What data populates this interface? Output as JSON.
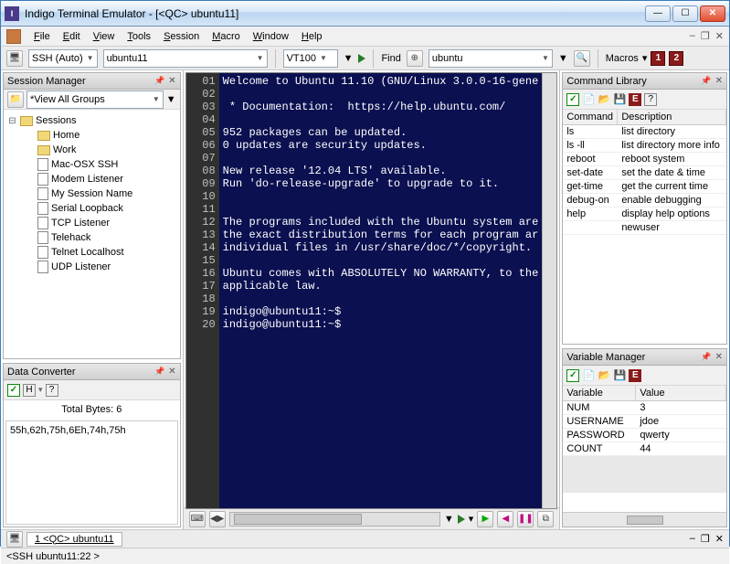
{
  "window": {
    "title": "Indigo Terminal Emulator - [<QC> ubuntu11]"
  },
  "menu": {
    "items": [
      "File",
      "Edit",
      "View",
      "Tools",
      "Session",
      "Macro",
      "Window",
      "Help"
    ]
  },
  "toolbar": {
    "conn_type": "SSH (Auto)",
    "host": "ubuntu11",
    "emulation": "VT100",
    "find_label": "Find",
    "find_value": "ubuntu",
    "macros_label": "Macros"
  },
  "session_mgr": {
    "title": "Session Manager",
    "filter": "*View All Groups",
    "root": "Sessions",
    "folders": [
      "Home",
      "Work"
    ],
    "items": [
      "Mac-OSX SSH",
      "Modem Listener",
      "My Session Name",
      "Serial Loopback",
      "TCP Listener",
      "Telehack",
      "Telnet Localhost",
      "UDP Listener"
    ]
  },
  "data_conv": {
    "title": "Data Converter",
    "total_label": "Total Bytes: 6",
    "hex": "55h,62h,75h,6Eh,74h,75h"
  },
  "terminal": {
    "lines": [
      "Welcome to Ubuntu 11.10 (GNU/Linux 3.0.0-16-gene",
      "",
      " * Documentation:  https://help.ubuntu.com/",
      "",
      "952 packages can be updated.",
      "0 updates are security updates.",
      "",
      "New release '12.04 LTS' available.",
      "Run 'do-release-upgrade' to upgrade to it.",
      "",
      "",
      "The programs included with the Ubuntu system are",
      "the exact distribution terms for each program ar",
      "individual files in /usr/share/doc/*/copyright.",
      "",
      "Ubuntu comes with ABSOLUTELY NO WARRANTY, to the",
      "applicable law.",
      "",
      "indigo@ubuntu11:~$",
      "indigo@ubuntu11:~$"
    ],
    "first_line_no": 1
  },
  "cmd_lib": {
    "title": "Command Library",
    "cols": [
      "Command",
      "Description"
    ],
    "rows": [
      [
        "ls",
        "list directory"
      ],
      [
        "ls -ll",
        "list directory more info"
      ],
      [
        "reboot",
        "reboot system"
      ],
      [
        "set-date",
        "set the date & time"
      ],
      [
        "get-time",
        "get the current time"
      ],
      [
        "debug-on",
        "enable debugging"
      ],
      [
        "help",
        "display help options"
      ],
      [
        "",
        "newuser"
      ]
    ]
  },
  "var_mgr": {
    "title": "Variable Manager",
    "cols": [
      "Variable",
      "Value"
    ],
    "rows": [
      [
        "NUM",
        "3"
      ],
      [
        "USERNAME",
        "jdoe"
      ],
      [
        "PASSWORD",
        "qwerty"
      ],
      [
        "COUNT",
        "44"
      ]
    ]
  },
  "tabbar": {
    "tab": "1 <QC> ubuntu11"
  },
  "status": {
    "text": "<SSH ubuntu11:22 >"
  }
}
